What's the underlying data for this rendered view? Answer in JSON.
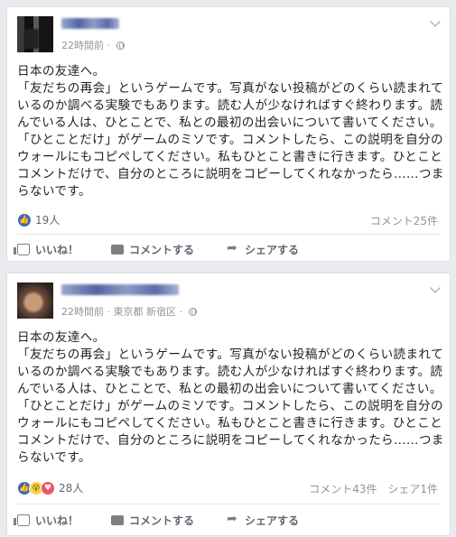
{
  "posts": [
    {
      "time": "22時間前",
      "location": "",
      "body": "日本の友達へ。\n「友だちの再会」というゲームです。写真がない投稿がどのくらい読まれているのか調べる実験でもあります。読む人が少なければすぐ終わります。読んでいる人は、ひとことで、私との最初の出会いについて書いてください。「ひとことだけ」がゲームのミソです。コメントしたら、この説明を自分のウォールにもコピペしてください。私もひとこと書きに行きます。ひとことコメントだけで、自分のところに説明をコピーしてくれなかったら……つまらないです。",
      "reaction_count": "19人",
      "comments": "コメント25件",
      "shares": "",
      "actions": {
        "like": "いいね！",
        "comment": "コメントする",
        "share": "シェアする"
      }
    },
    {
      "time": "22時間前",
      "location": "東京都 新宿区",
      "body": "日本の友達へ。\n「友だちの再会」というゲームです。写真がない投稿がどのくらい読まれているのか調べる実験でもあります。読む人が少なければすぐ終わります。読んでいる人は、ひとことで、私との最初の出会いについて書いてください。「ひとことだけ」がゲームのミソです。コメントしたら、この説明を自分のウォールにもコピペしてください。私もひとこと書きに行きます。ひとことコメントだけで、自分のところに説明をコピーしてくれなかったら……つまらないです。",
      "reaction_count": "28人",
      "comments": "コメント43件",
      "shares": "シェア1件",
      "actions": {
        "like": "いいね！",
        "comment": "コメントする",
        "share": "シェアする"
      }
    }
  ],
  "colors": {
    "background": "#e9ebee",
    "like_blue": "#4267b2",
    "love_red": "#f25268",
    "wow_yellow": "#f7d44a"
  }
}
